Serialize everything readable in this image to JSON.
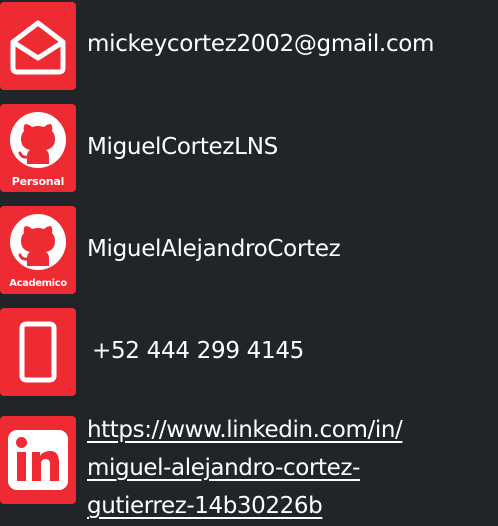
{
  "contacts": {
    "email": {
      "icon": "email-icon",
      "value": "mickeycortez2002@gmail.com"
    },
    "github_personal": {
      "icon": "github-icon",
      "caption": "Personal",
      "value": "MiguelCortezLNS"
    },
    "github_academic": {
      "icon": "github-icon",
      "caption": "Academico",
      "value": "MiguelAlejandroCortez"
    },
    "phone": {
      "icon": "mobile-phone-icon",
      "value": "+52 444 299 4145"
    },
    "linkedin": {
      "icon": "linkedin-icon",
      "line1": "https://www.linkedin.com/in/",
      "line2": "miguel-alejandro-cortez-",
      "line3": "gutierrez-14b30226b"
    }
  },
  "colors": {
    "background": "#212529",
    "tile": "#ee2a32",
    "text": "#ffffff"
  }
}
